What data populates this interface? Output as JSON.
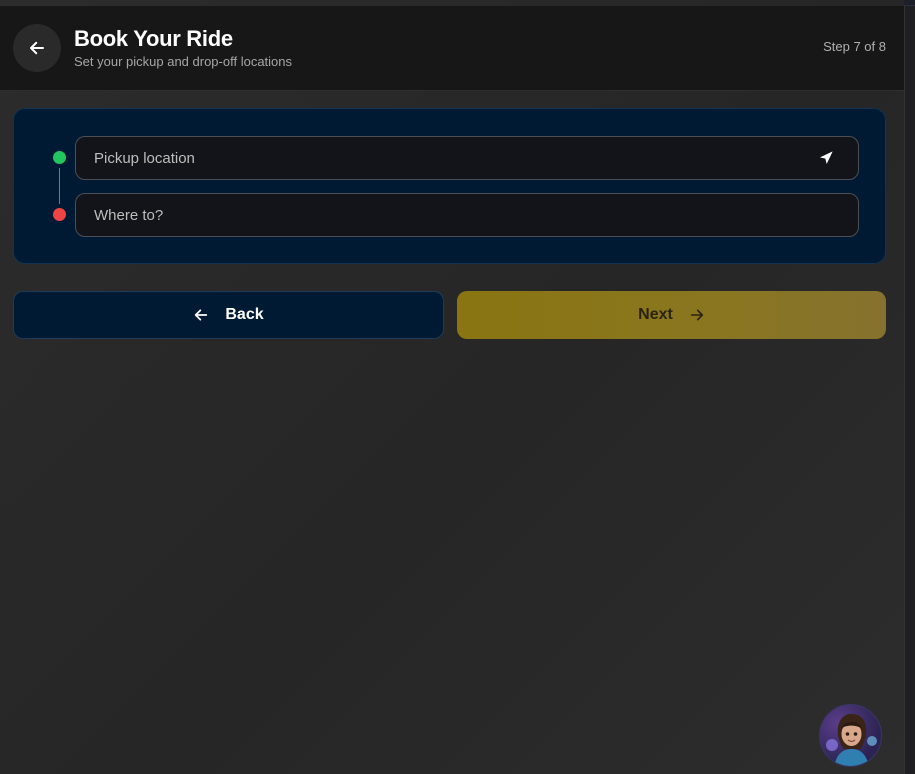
{
  "header": {
    "title": "Book Your Ride",
    "subtitle": "Set your pickup and drop-off locations",
    "step": "Step 7 of 8",
    "back_icon": "arrow-left-icon"
  },
  "locations": {
    "pickup": {
      "placeholder": "Pickup location",
      "icon": "navigation-arrow-icon",
      "dot_color": "#22c55e"
    },
    "dropoff": {
      "placeholder": "Where to?",
      "dot_color": "#ef4444"
    }
  },
  "actions": {
    "back_label": "Back",
    "next_label": "Next",
    "back_icon": "arrow-left-icon",
    "next_icon": "arrow-right-icon"
  },
  "colors": {
    "accent": "#8a7512",
    "card_bg": "#011a33",
    "header_bg": "#171717"
  },
  "assistant": {
    "icon": "assistant-avatar-icon"
  }
}
